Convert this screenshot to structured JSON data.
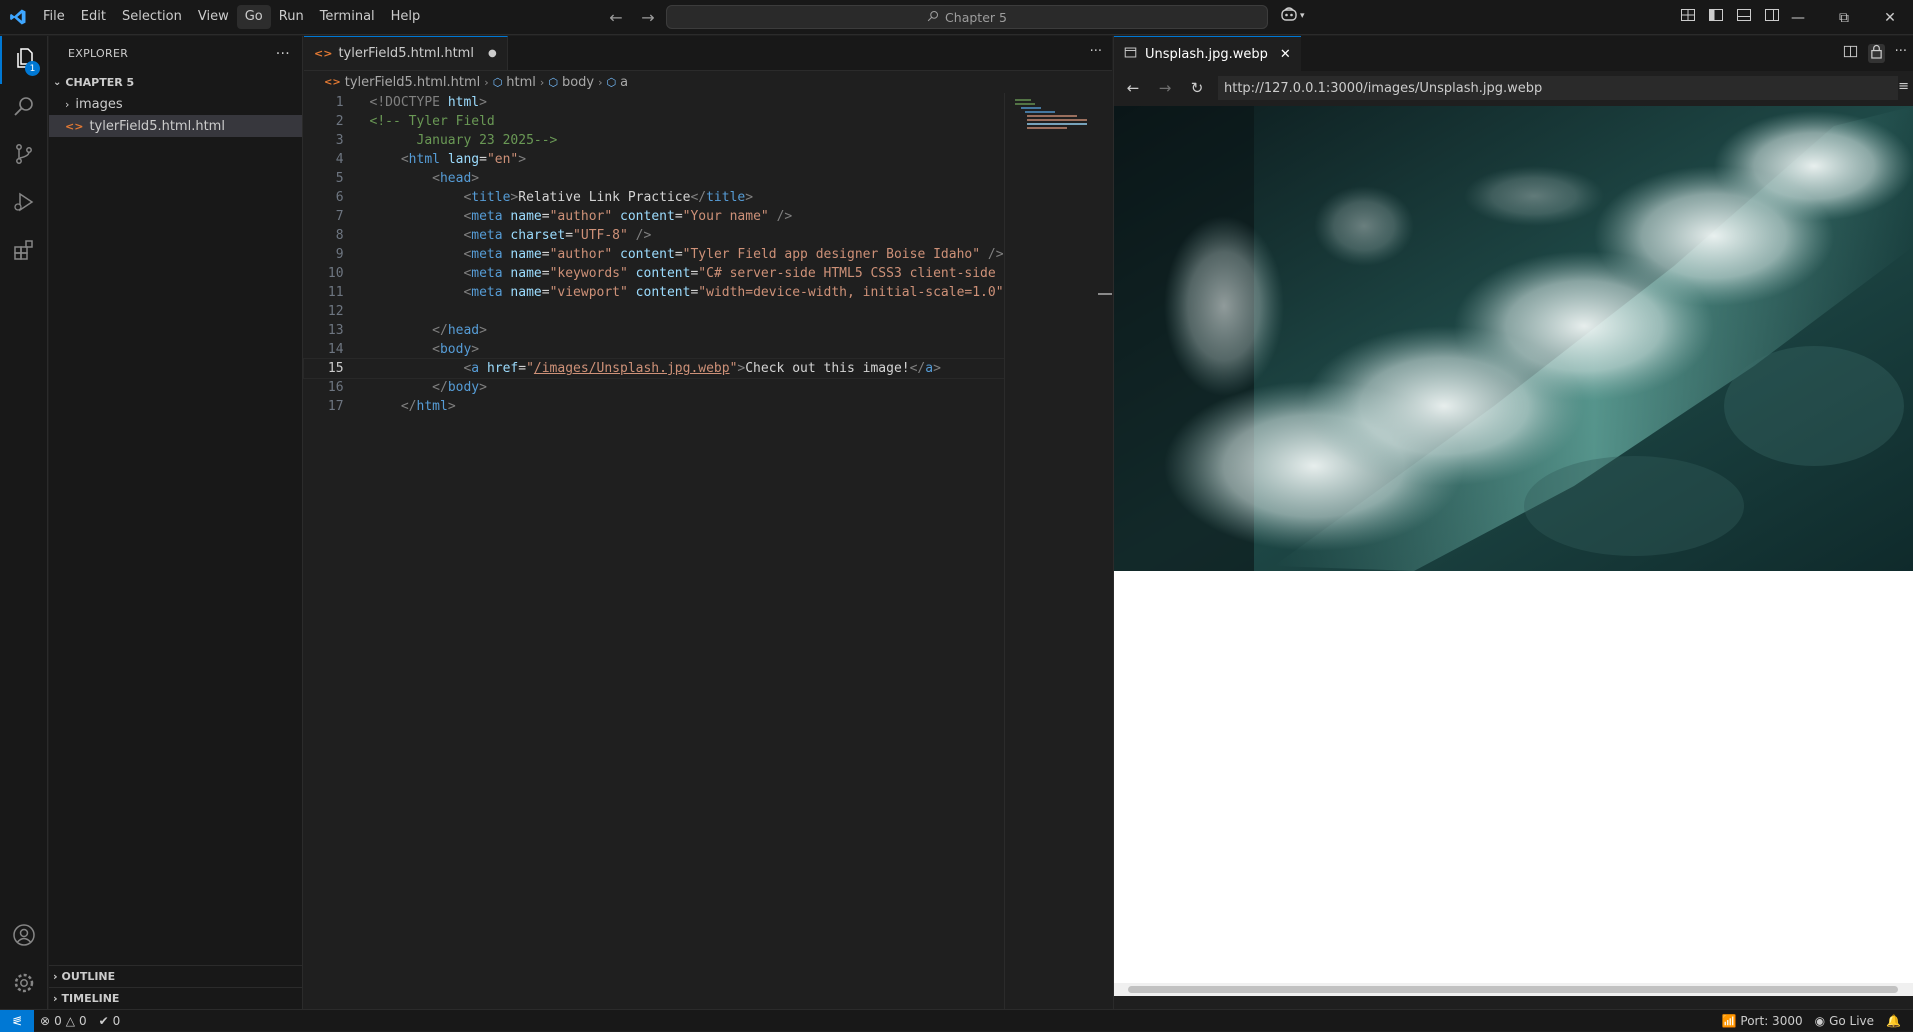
{
  "titlebar": {
    "menu": [
      "File",
      "Edit",
      "Selection",
      "View",
      "Go",
      "Run",
      "Terminal",
      "Help"
    ],
    "active_menu_index": 4,
    "search_text": "Chapter 5"
  },
  "activitybar": {
    "explorer_badge": "1"
  },
  "sidebar": {
    "title": "EXPLORER",
    "folder": "CHAPTER 5",
    "items": [
      {
        "label": "images",
        "type": "folder"
      },
      {
        "label": "tylerField5.html.html",
        "type": "file"
      }
    ],
    "outline": "OUTLINE",
    "timeline": "TIMELINE"
  },
  "editor": {
    "tab_label": "tylerField5.html.html",
    "breadcrumb": {
      "file": "tylerField5.html.html",
      "html": "html",
      "body": "body",
      "a": "a"
    },
    "line_numbers": [
      "1",
      "2",
      "3",
      "4",
      "5",
      "6",
      "7",
      "8",
      "9",
      "10",
      "11",
      "12",
      "13",
      "14",
      "15",
      "16",
      "17"
    ],
    "current_line": 15,
    "code": {
      "l1_doctype": "<!DOCTYPE ",
      "l1_html": "html",
      "l1_end": ">",
      "l2": "<!-- Tyler Field",
      "l3": "      January 23 2025-->",
      "l4_lang": "\"en\"",
      "l6_title": "Relative Link Practice",
      "l7_author": "\"author\"",
      "l7_content": "\"Your name\"",
      "l8_charset": "\"UTF-8\"",
      "l9_author": "\"author\"",
      "l9_content": "\"Tyler Field app designer Boise Idaho\"",
      "l10_keywords": "\"keywords\"",
      "l10_content": "\"C# server-side HTML5 CSS3 client-side \"",
      "l11_viewport": "\"viewport\"",
      "l11_content": "\"width=device-width, initial-scale=1.0\"",
      "l15_href": "/images/Unsplash.jpg.webp",
      "l15_text": "Check out this image!"
    }
  },
  "preview": {
    "tab_label": "Unsplash.jpg.webp",
    "url": "http://127.0.0.1:3000/images/Unsplash.jpg.webp"
  },
  "statusbar": {
    "errors": "0",
    "warnings": "0",
    "ports": "0",
    "port_label": "Port: 3000",
    "go_live": "Go Live"
  },
  "colors": {
    "accent": "#0078d4",
    "background": "#1f1f1f",
    "sidebar": "#181818"
  }
}
